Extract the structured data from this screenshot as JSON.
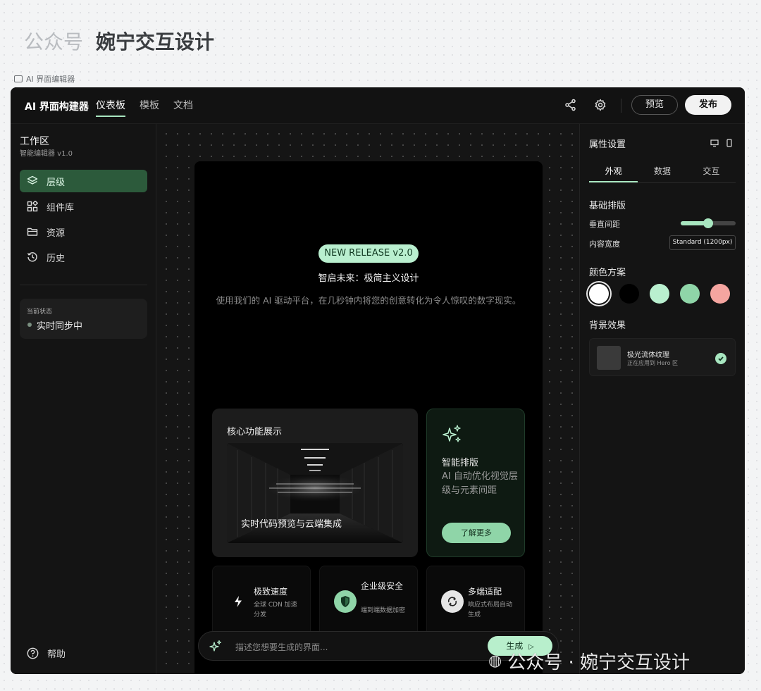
{
  "watermark": {
    "prefix": "公众号",
    "name": "婉宁交互设计"
  },
  "breadcrumb": "AI 界面编辑器",
  "topbar": {
    "brand": "AI 界面构建器",
    "nav": [
      "仪表板",
      "模板",
      "文档"
    ],
    "active_nav": "仪表板",
    "icons": [
      "share-icon",
      "gear-icon"
    ],
    "preview_label": "预览",
    "publish_label": "发布"
  },
  "sidebar": {
    "title": "工作区",
    "subtitle": "智能编辑器 v1.0",
    "items": [
      {
        "label": "层级",
        "icon": "layers-icon",
        "active": true
      },
      {
        "label": "组件库",
        "icon": "components-icon",
        "active": false
      },
      {
        "label": "资源",
        "icon": "folder-icon",
        "active": false
      },
      {
        "label": "历史",
        "icon": "history-icon",
        "active": false
      }
    ],
    "status": {
      "label": "当前状态",
      "text": "实时同步中"
    },
    "help": "帮助"
  },
  "canvas": {
    "badge": "NEW RELEASE v2.0",
    "hero_title": "智启未来：极简主义设计",
    "hero_desc": "使用我们的 AI 驱动平台，在几秒钟内将您的创意转化为令人惊叹的数字现实。",
    "feature_card": {
      "title": "核心功能展示",
      "caption": "实时代码预览与云端集成"
    },
    "smart_card": {
      "icon": "sparkles-icon",
      "title": "智能排版",
      "desc": "AI 自动优化视觉层级与元素间距",
      "button": "了解更多"
    },
    "mini_cards": [
      {
        "icon": "bolt-icon",
        "title": "极致速度",
        "sub": "全球 CDN 加速分发"
      },
      {
        "icon": "shield-icon",
        "title": "企业级安全",
        "sub": "端到端数据加密"
      },
      {
        "icon": "sync-icon",
        "title": "多端适配",
        "sub": "响应式布局自动生成"
      }
    ],
    "prompt": {
      "placeholder": "描述您想要生成的界面...",
      "button": "生成"
    }
  },
  "properties": {
    "title": "属性设置",
    "tabs": [
      "外观",
      "数据",
      "交互"
    ],
    "active_tab": "外观",
    "layout_section": "基础排版",
    "vertical_spacing_label": "垂直间距",
    "vertical_spacing_value": 0.5,
    "content_width_label": "内容宽度",
    "content_width_value": "Standard (1200px)",
    "color_section": "颜色方案",
    "colors": [
      "#ffffff",
      "#000000",
      "#b9efcf",
      "#8fd5a8",
      "#f5a5a0"
    ],
    "selected_color": "#ffffff",
    "bg_section": "背景效果",
    "bg_name": "极光流体纹理",
    "bg_sub": "正在应用到 Hero 区"
  },
  "colors": {
    "accent": "#a8e6c0",
    "active_menu": "#2c5a3b",
    "app_bg": "#101010"
  }
}
